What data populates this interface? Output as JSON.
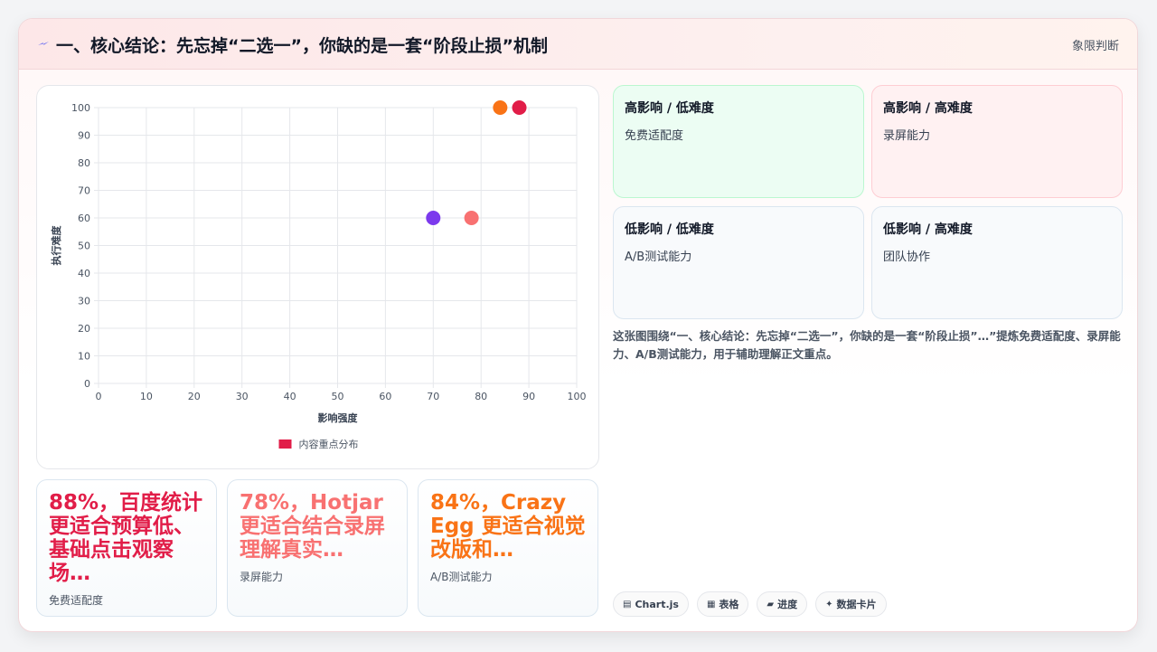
{
  "header": {
    "title": "一、核心结论：先忘掉“二选一”，你缺的是一套“阶段止损”机制",
    "tag": "象限判断",
    "icon": "bolt-icon"
  },
  "chart_data": {
    "type": "scatter",
    "title": "",
    "xlabel": "影响强度",
    "ylabel": "执行难度",
    "xlim": [
      0,
      100
    ],
    "ylim": [
      0,
      100
    ],
    "x_ticks": [
      "0",
      "10",
      "20",
      "30",
      "40",
      "50",
      "60",
      "70",
      "80",
      "90",
      "100"
    ],
    "y_ticks": [
      "0",
      "10",
      "20",
      "30",
      "40",
      "50",
      "60",
      "70",
      "80",
      "90",
      "100"
    ],
    "grid": true,
    "legend_position": "bottom",
    "series": [
      {
        "name": "内容重点分布",
        "points": [
          {
            "x": 84,
            "y": 100,
            "color": "#f97316"
          },
          {
            "x": 88,
            "y": 100,
            "color": "#e11d48"
          },
          {
            "x": 70,
            "y": 60,
            "color": "#7c3aed"
          },
          {
            "x": 78,
            "y": 60,
            "color": "#f87171"
          }
        ]
      }
    ],
    "legend_color": "#e11d48"
  },
  "stats": [
    {
      "value": "88%，百度统计更适合预算低、基础点击观察场…",
      "label": "免费适配度",
      "color": "#e11d48"
    },
    {
      "value": "78%，Hotjar 更适合结合录屏理解真实…",
      "label": "录屏能力",
      "color": "#f87171"
    },
    {
      "value": "84%，Crazy Egg 更适合视觉改版和…",
      "label": "A/B测试能力",
      "color": "#f97316"
    }
  ],
  "quadrants": [
    {
      "title": "高影响 / 低难度",
      "value": "免费适配度",
      "bg": "#ecfdf3",
      "border": "#bbf7d0"
    },
    {
      "title": "高影响 / 高难度",
      "value": "录屏能力",
      "bg": "#fff1f2",
      "border": "#fecdd3"
    },
    {
      "title": "低影响 / 低难度",
      "value": "A/B测试能力",
      "bg": "#f8fafc",
      "border": "#dbe6f0"
    },
    {
      "title": "低影响 / 高难度",
      "value": "团队协作",
      "bg": "#f8fafc",
      "border": "#dbe6f0"
    }
  ],
  "description": "这张图围绕“一、核心结论：先忘掉“二选一”，你缺的是一套“阶段止损”…”提炼免费适配度、录屏能力、A/B测试能力，用于辅助理解正文重点。",
  "chips": [
    {
      "icon": "chart-icon",
      "glyph": "▤",
      "label": "Chart.js"
    },
    {
      "icon": "table-icon",
      "glyph": "▦",
      "label": "表格"
    },
    {
      "icon": "progress-icon",
      "glyph": "▰",
      "label": "进度"
    },
    {
      "icon": "sparkle-icon",
      "glyph": "✦",
      "label": "数据卡片"
    }
  ]
}
